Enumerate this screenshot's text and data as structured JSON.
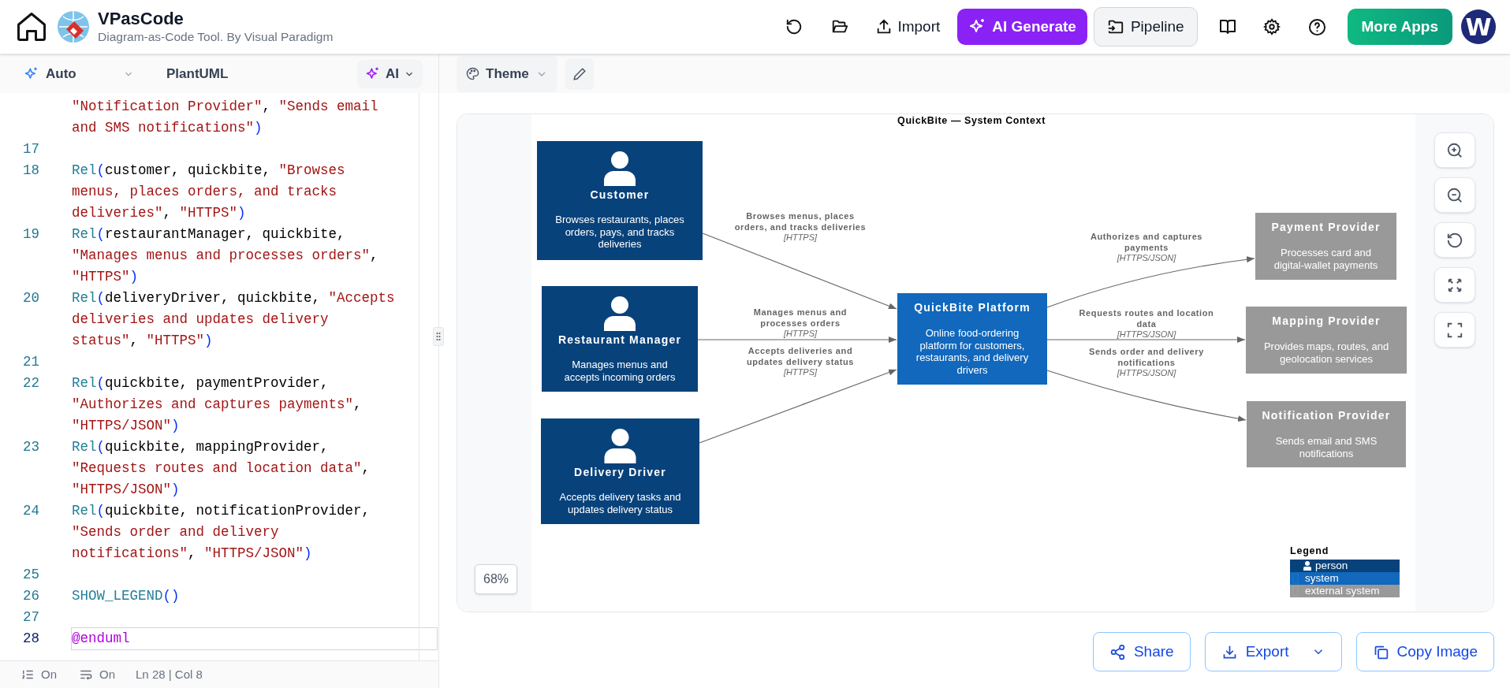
{
  "app": {
    "name": "VPasCode",
    "tagline": "Diagram-as-Code Tool. By Visual Paradigm"
  },
  "header": {
    "import_button": "Import",
    "ai_generate_button": "AI Generate",
    "pipeline_button": "Pipeline",
    "more_apps_button": "More Apps",
    "avatar": "W"
  },
  "editor_toolbar": {
    "mode": "Auto",
    "language": "PlantUML",
    "ai_button": "AI"
  },
  "code_lines": [
    {
      "tokens": [
        {
          "kind": "str",
          "text": "\"Notification Provider\""
        },
        {
          "kind": "plain",
          "text": ", "
        },
        {
          "kind": "str",
          "text": "\"Sends email and SMS notifications\""
        },
        {
          "kind": "punc",
          "text": ")"
        }
      ],
      "current": false
    },
    {
      "number": "17",
      "current": false
    },
    {
      "number": "18",
      "tokens": [
        {
          "kind": "fn",
          "text": "Rel"
        },
        {
          "kind": "punc",
          "text": "("
        },
        {
          "kind": "plain",
          "text": "customer, quickbite, "
        },
        {
          "kind": "str",
          "text": "\"Browses menus, places orders, and tracks deliveries\""
        },
        {
          "kind": "plain",
          "text": ", "
        },
        {
          "kind": "str",
          "text": "\"HTTPS\""
        },
        {
          "kind": "punc",
          "text": ")"
        }
      ],
      "current": false
    },
    {
      "number": "19",
      "tokens": [
        {
          "kind": "fn",
          "text": "Rel"
        },
        {
          "kind": "punc",
          "text": "("
        },
        {
          "kind": "plain",
          "text": "restaurantManager, quickbite, "
        },
        {
          "kind": "str",
          "text": "\"Manages menus and processes orders\""
        },
        {
          "kind": "plain",
          "text": ", "
        },
        {
          "kind": "str",
          "text": "\"HTTPS\""
        },
        {
          "kind": "punc",
          "text": ")"
        }
      ],
      "current": false
    },
    {
      "number": "20",
      "tokens": [
        {
          "kind": "fn",
          "text": "Rel"
        },
        {
          "kind": "punc",
          "text": "("
        },
        {
          "kind": "plain",
          "text": "deliveryDriver, quickbite, "
        },
        {
          "kind": "str",
          "text": "\"Accepts deliveries and updates delivery status\""
        },
        {
          "kind": "plain",
          "text": ", "
        },
        {
          "kind": "str",
          "text": "\"HTTPS\""
        },
        {
          "kind": "punc",
          "text": ")"
        }
      ],
      "current": false
    },
    {
      "number": "21",
      "current": false
    },
    {
      "number": "22",
      "tokens": [
        {
          "kind": "fn",
          "text": "Rel"
        },
        {
          "kind": "punc",
          "text": "("
        },
        {
          "kind": "plain",
          "text": "quickbite, paymentProvider, "
        },
        {
          "kind": "str",
          "text": "\"Authorizes and captures payments\""
        },
        {
          "kind": "plain",
          "text": ", "
        },
        {
          "kind": "str",
          "text": "\"HTTPS/JSON\""
        },
        {
          "kind": "punc",
          "text": ")"
        }
      ],
      "current": false
    },
    {
      "number": "23",
      "tokens": [
        {
          "kind": "fn",
          "text": "Rel"
        },
        {
          "kind": "punc",
          "text": "("
        },
        {
          "kind": "plain",
          "text": "quickbite, mappingProvider, "
        },
        {
          "kind": "str",
          "text": "\"Requests routes and location data\""
        },
        {
          "kind": "plain",
          "text": ", "
        },
        {
          "kind": "str",
          "text": "\"HTTPS/JSON\""
        },
        {
          "kind": "punc",
          "text": ")"
        }
      ],
      "current": false
    },
    {
      "number": "24",
      "tokens": [
        {
          "kind": "fn",
          "text": "Rel"
        },
        {
          "kind": "punc",
          "text": "("
        },
        {
          "kind": "plain",
          "text": "quickbite, notificationProvider, "
        },
        {
          "kind": "str",
          "text": "\"Sends order and delivery notifications\""
        },
        {
          "kind": "plain",
          "text": ", "
        },
        {
          "kind": "str",
          "text": "\"HTTPS/JSON\""
        },
        {
          "kind": "punc",
          "text": ")"
        }
      ],
      "current": false
    },
    {
      "number": "25",
      "current": false
    },
    {
      "number": "26",
      "tokens": [
        {
          "kind": "fn",
          "text": "SHOW_LEGEND"
        },
        {
          "kind": "punc",
          "text": "()"
        }
      ],
      "current": false
    },
    {
      "number": "27",
      "current": false
    },
    {
      "number": "28",
      "tokens": [
        {
          "kind": "kw",
          "text": "@enduml"
        }
      ],
      "current": true
    }
  ],
  "status_bar": {
    "line_numbers": "On",
    "word_wrap": "On",
    "position": "Ln 28 | Col 8"
  },
  "preview_toolbar": {
    "theme_button": "Theme"
  },
  "diagram": {
    "title": "QuickBite — System Context",
    "nodes": [
      {
        "kind": "person",
        "title": "Customer",
        "description": [
          "Browses restaurants, places",
          "orders, pays, and tracks",
          "deliveries"
        ]
      },
      {
        "kind": "person",
        "title": "Restaurant Manager",
        "description": [
          "Manages menus and",
          "accepts incoming orders"
        ]
      },
      {
        "kind": "person",
        "title": "Delivery Driver",
        "description": [
          "Accepts delivery tasks and",
          "updates delivery status"
        ]
      },
      {
        "kind": "system",
        "title": "QuickBite Platform",
        "description": [
          "Online food-ordering",
          "platform for customers,",
          "restaurants, and delivery",
          "drivers"
        ]
      },
      {
        "kind": "external",
        "title": "Payment Provider",
        "description": [
          "Processes card and",
          "digital-wallet payments"
        ]
      },
      {
        "kind": "external",
        "title": "Mapping Provider",
        "description": [
          "Provides maps, routes, and",
          "geolocation services"
        ]
      },
      {
        "kind": "external",
        "title": "Notification Provider",
        "description": [
          "Sends email and SMS",
          "notifications"
        ]
      }
    ],
    "relations": [
      {
        "label": [
          "Browses menus, places",
          "orders, and tracks deliveries"
        ],
        "technology": "[HTTPS]"
      },
      {
        "label": [
          "Manages menus and",
          "processes orders"
        ],
        "technology": "[HTTPS]"
      },
      {
        "label": [
          "Accepts deliveries and",
          "updates delivery status"
        ],
        "technology": "[HTTPS]"
      },
      {
        "label": [
          "Authorizes and captures",
          "payments"
        ],
        "technology": "[HTTPS/JSON]"
      },
      {
        "label": [
          "Requests routes and location",
          "data"
        ],
        "technology": "[HTTPS/JSON]"
      },
      {
        "label": [
          "Sends order and delivery",
          "notifications"
        ],
        "technology": "[HTTPS/JSON]"
      }
    ],
    "legend": {
      "title": "Legend",
      "items": [
        {
          "kind": "person",
          "label": "person",
          "color": "#08427b"
        },
        {
          "kind": "system",
          "label": "system",
          "color": "#1168bd"
        },
        {
          "kind": "external",
          "label": "external system",
          "color": "#999999"
        }
      ]
    }
  },
  "zoom_level": "68%",
  "actions": {
    "share_button": "Share",
    "export_button": "Export",
    "copy_image_button": "Copy Image"
  }
}
